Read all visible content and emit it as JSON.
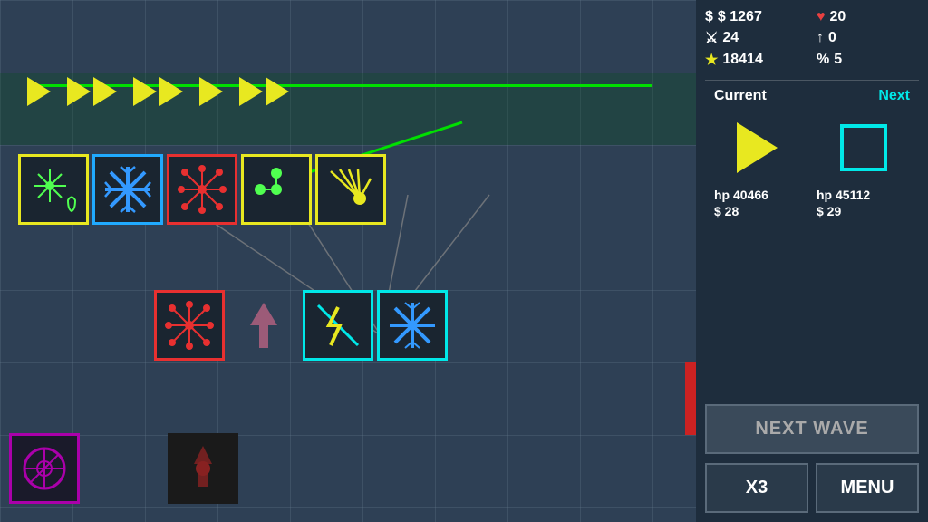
{
  "stats": {
    "money": "$ 1267",
    "hearts": "20",
    "sword": "24",
    "arrow_up": "0",
    "star": "18414",
    "percent": "5",
    "current_label": "Current",
    "next_label": "Next",
    "current_hp": "hp 40466",
    "current_cost": "$ 28",
    "next_hp": "hp 45112",
    "next_cost": "$ 29"
  },
  "buttons": {
    "next_wave": "NEXT WAVE",
    "x3": "X3",
    "menu": "MENU"
  },
  "icons": {
    "money": "$",
    "heart": "♥",
    "sword": "⚔",
    "up_arrow": "↑",
    "star": "★",
    "percent": "%"
  }
}
